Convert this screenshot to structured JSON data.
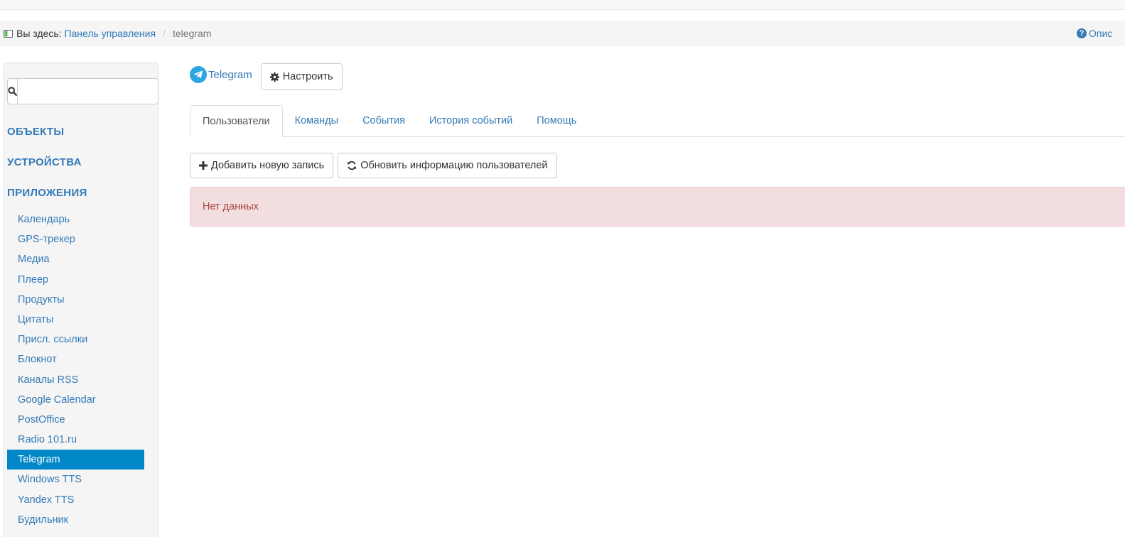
{
  "breadcrumb": {
    "prefix": "Вы здесь:",
    "home": "Панель управления",
    "separator": "/",
    "current": "telegram",
    "help": "Опис"
  },
  "sidebar": {
    "search": {
      "value": "",
      "placeholder": ""
    },
    "sections": [
      "ОБЪЕКТЫ",
      "УСТРОЙСТВА",
      "ПРИЛОЖЕНИЯ"
    ],
    "items": [
      "Календарь",
      "GPS-трекер",
      "Медиа",
      "Плеер",
      "Продукты",
      "Цитаты",
      "Присл. ссылки",
      "Блокнот",
      "Каналы RSS",
      "Google Calendar",
      "PostOffice",
      "Radio 101.ru",
      "Telegram",
      "Windows TTS",
      "Yandex TTS",
      "Будильник"
    ],
    "active_item": "Telegram"
  },
  "module": {
    "title": "Telegram",
    "settings_label": "Настроить"
  },
  "tabs": [
    "Пользователи",
    "Команды",
    "События",
    "История событий",
    "Помощь"
  ],
  "active_tab": "Пользователи",
  "actions": {
    "add_label": "Добавить новую запись",
    "refresh_label": "Обновить информацию пользователей"
  },
  "alert": {
    "text": "Нет данных"
  },
  "colors": {
    "link": "#337ab7",
    "active_nav": "#0087c8",
    "alert_bg": "#f2dede",
    "alert_text": "#a94442",
    "telegram": "#2ca5e0"
  }
}
